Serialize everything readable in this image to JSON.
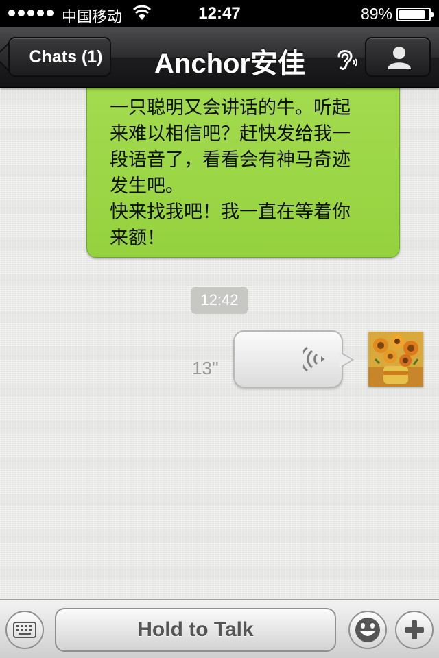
{
  "status_bar": {
    "carrier": "中国移动",
    "time": "12:47",
    "battery": "89%",
    "battery_level": 0.89,
    "signal_bars": 5,
    "wifi_icon": "wifi-icon"
  },
  "nav": {
    "back_label": "Chats (1)",
    "title": "Anchor安佳",
    "ear_icon": "ear-icon",
    "profile_icon": "person-icon"
  },
  "messages": {
    "incoming_lines": [
      "一只聪明又会讲话的牛。听起",
      "来难以相信吧？赶快发给我一",
      "段语音了，看看会有神马奇迹",
      "发生吧。",
      "快来找我吧！我一直在等着你",
      "来额！"
    ],
    "timestamp": "12:42",
    "voice_duration": "13''",
    "colors": {
      "incoming_bubble": "#9bd646",
      "voice_bubble": "#eeeeee"
    }
  },
  "toolbar": {
    "keyboard_icon": "keyboard-icon",
    "hold_to_talk": "Hold to Talk",
    "emoji_icon": "smiley-icon",
    "plus_icon": "plus-icon"
  }
}
